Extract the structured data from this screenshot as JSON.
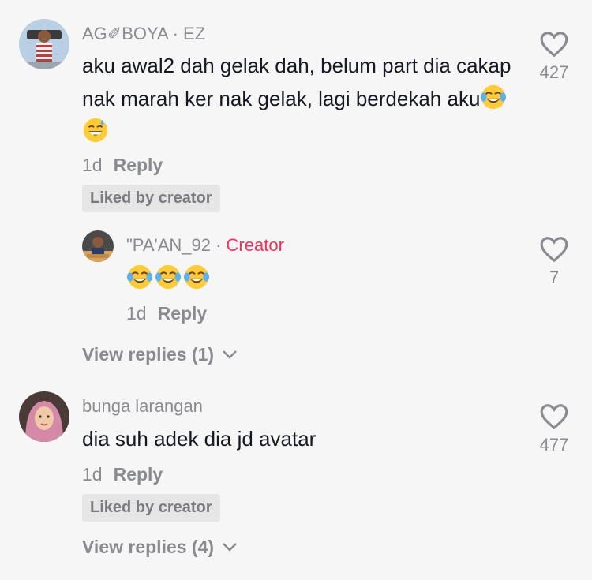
{
  "comments": [
    {
      "username": "AG✐BOYA · EZ",
      "text": "aku awal2 dah gelak dah, belum part dia cakap nak marah ker nak gelak, lagi berdekah aku",
      "emojis": [
        "face-with-tears-of-joy",
        "grinning-face-with-sweat"
      ],
      "time": "1d",
      "reply_label": "Reply",
      "liked_badge": "Liked by creator",
      "likes": "427",
      "reply": {
        "username": "\"PA'AN_92 · ",
        "creator_tag": "Creator",
        "emojis": [
          "face-with-tears-of-joy",
          "face-with-tears-of-joy",
          "face-with-tears-of-joy"
        ],
        "time": "1d",
        "reply_label": "Reply",
        "likes": "7"
      },
      "view_replies": "View replies (1)"
    },
    {
      "username": "bunga larangan",
      "text": "dia suh adek dia jd avatar",
      "time": "1d",
      "reply_label": "Reply",
      "liked_badge": "Liked by creator",
      "likes": "477",
      "view_replies": "View replies (4)"
    }
  ],
  "colors": {
    "background": "#f6f6f6",
    "creator": "#fe2c55",
    "muted": "#8a8b91",
    "text": "#161823"
  }
}
